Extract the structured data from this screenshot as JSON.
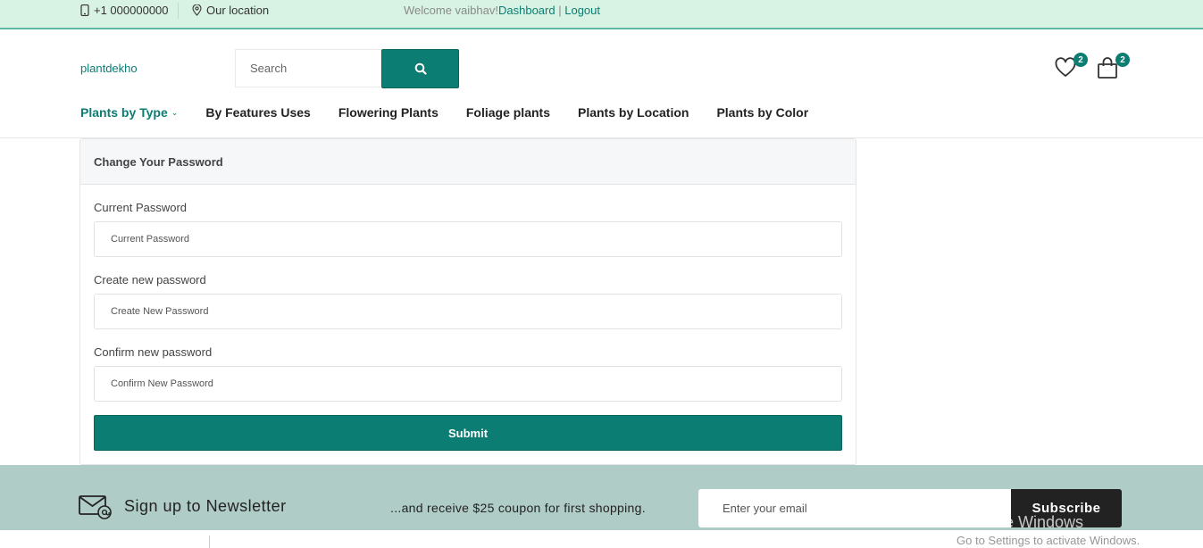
{
  "topbar": {
    "phone": "+1 000000000",
    "location": "Our location",
    "welcome": "Welcome vaibhav!",
    "dashboard": "Dashboard",
    "separator": "|",
    "logout": "Logout"
  },
  "header": {
    "logo": "plantdekho",
    "search_placeholder": "Search",
    "wishlist_count": "2",
    "cart_count": "2"
  },
  "nav": {
    "items": [
      {
        "label": "Plants by Type"
      },
      {
        "label": "By Features Uses"
      },
      {
        "label": "Flowering Plants"
      },
      {
        "label": "Foliage plants"
      },
      {
        "label": "Plants by Location"
      },
      {
        "label": "Plants by Color"
      }
    ]
  },
  "form": {
    "title": "Change Your Password",
    "current_label": "Current Password",
    "current_placeholder": "Current Password",
    "new_label": "Create new password",
    "new_placeholder": "Create New Password",
    "confirm_label": "Confirm new password",
    "confirm_placeholder": "Confirm New Password",
    "submit": "Submit"
  },
  "newsletter": {
    "title": "Sign up to Newsletter",
    "subtitle": "...and receive $25 coupon for first shopping.",
    "email_placeholder": "Enter your email",
    "button": "Subscribe"
  },
  "watermark": {
    "line1": "Activate Windows",
    "line2": "Go to Settings to activate Windows."
  },
  "colors": {
    "primary": "#0b7d72",
    "topbar_bg": "#d8f3e3",
    "newsletter_bg": "#b0ccc6",
    "dark_button": "#222222"
  }
}
